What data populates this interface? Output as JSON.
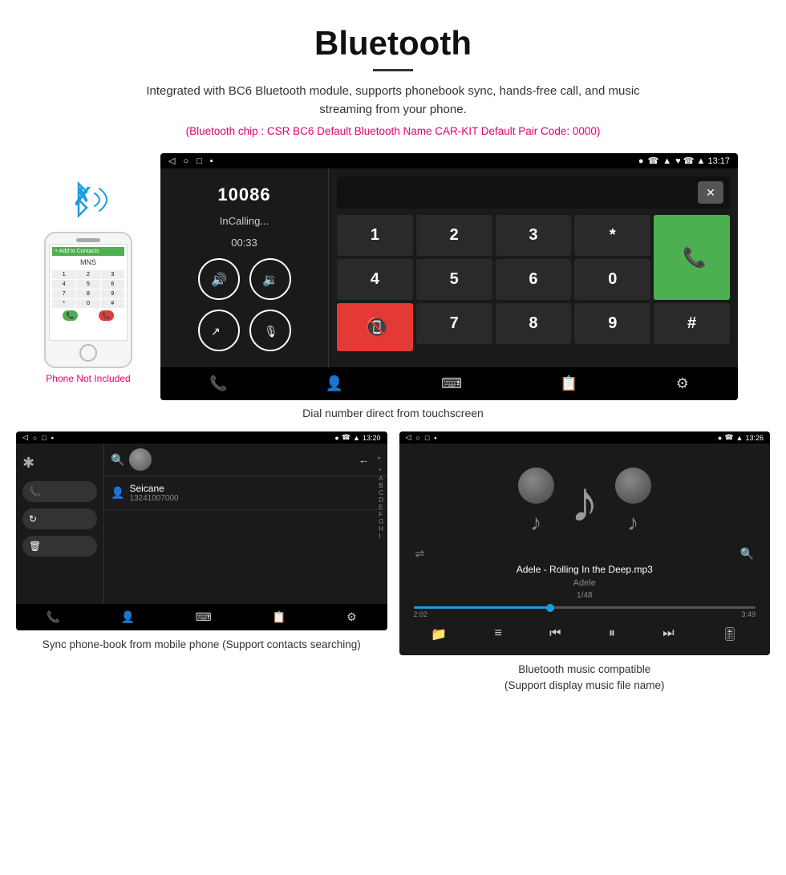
{
  "header": {
    "title": "Bluetooth",
    "description": "Integrated with BC6 Bluetooth module, supports phonebook sync, hands-free call, and music streaming from your phone.",
    "info_line": "(Bluetooth chip : CSR BC6    Default Bluetooth Name CAR-KIT    Default Pair Code: 0000)"
  },
  "dial_screen": {
    "status_bar": {
      "left_icons": [
        "◁",
        "○",
        "□",
        "▪"
      ],
      "right": "♥  ☎  ▲  13:17"
    },
    "number": "10086",
    "status": "InCalling...",
    "timer": "00:33",
    "keypad": [
      "1",
      "2",
      "3",
      "*",
      "4",
      "5",
      "6",
      "0",
      "7",
      "8",
      "9",
      "#"
    ],
    "caption": "Dial number direct from touchscreen"
  },
  "phonebook_screen": {
    "time": "13:20",
    "contact_name": "Seicane",
    "contact_number": "13241007000",
    "alpha_list": [
      "*",
      "A",
      "B",
      "C",
      "D",
      "E",
      "F",
      "G",
      "H",
      "I"
    ],
    "caption": "Sync phone-book from mobile phone\n(Support contacts searching)"
  },
  "music_screen": {
    "time": "13:26",
    "song": "Adele - Rolling In the Deep.mp3",
    "artist": "Adele",
    "track": "1/48",
    "time_elapsed": "2:02",
    "time_total": "3:49",
    "caption": "Bluetooth music compatible\n(Support display music file name)"
  },
  "phone_illustration": {
    "not_included": "Phone Not Included"
  }
}
